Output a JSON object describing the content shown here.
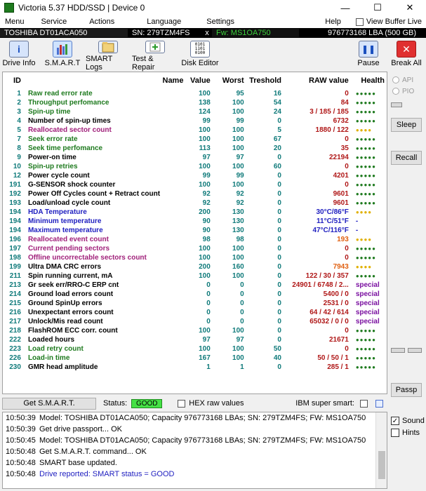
{
  "window": {
    "title": "Victoria 5.37 HDD/SSD | Device 0"
  },
  "menu": {
    "items": [
      "Menu",
      "Service",
      "Actions",
      "Language",
      "Settings"
    ],
    "help": "Help",
    "view_buffer_live": "View Buffer Live"
  },
  "device": {
    "model": "TOSHIBA DT01ACA050",
    "serial": "SN: 279TZM4FS",
    "close": "x",
    "firmware": "Fw: MS1OA750",
    "lba": "976773168 LBA (500 GB)"
  },
  "toolbar": {
    "drive_info": "Drive Info",
    "smart": "S.M.A.R.T",
    "smart_logs": "SMART Logs",
    "test_repair": "Test & Repair",
    "disk_editor": "Disk Editor",
    "pause": "Pause",
    "break_all": "Break All"
  },
  "table": {
    "headers": {
      "id": "ID",
      "name": "Name",
      "value": "Value",
      "worst": "Worst",
      "threshold": "Treshold",
      "raw": "RAW value",
      "health": "Health"
    },
    "rows": [
      {
        "id": "1",
        "name": "Raw read error rate",
        "value": "100",
        "worst": "95",
        "threshold": "16",
        "raw": "0",
        "health": "●●●●●",
        "name_color": "#1e7a1e",
        "raw_color": "#b01818",
        "health_color": "#1e7a1e"
      },
      {
        "id": "2",
        "name": "Throughput perfomance",
        "value": "138",
        "worst": "100",
        "threshold": "54",
        "raw": "84",
        "health": "●●●●●",
        "name_color": "#1e7a1e",
        "raw_color": "#b01818",
        "health_color": "#1e7a1e"
      },
      {
        "id": "3",
        "name": "Spin-up time",
        "value": "124",
        "worst": "100",
        "threshold": "24",
        "raw": "3 / 185 / 185",
        "health": "●●●●●",
        "name_color": "#1e7a1e",
        "raw_color": "#b01818",
        "health_color": "#1e7a1e"
      },
      {
        "id": "4",
        "name": "Number of spin-up times",
        "value": "99",
        "worst": "99",
        "threshold": "0",
        "raw": "6732",
        "health": "●●●●●",
        "name_color": "#000000",
        "raw_color": "#b01818",
        "health_color": "#1e7a1e"
      },
      {
        "id": "5",
        "name": "Reallocated sector count",
        "value": "100",
        "worst": "100",
        "threshold": "5",
        "raw": "1880 / 122",
        "health": "●●●●",
        "name_color": "#a0207a",
        "raw_color": "#b01818",
        "health_color": "#e0b000"
      },
      {
        "id": "7",
        "name": "Seek error rate",
        "value": "100",
        "worst": "100",
        "threshold": "67",
        "raw": "0",
        "health": "●●●●●",
        "name_color": "#1e7a1e",
        "raw_color": "#b01818",
        "health_color": "#1e7a1e"
      },
      {
        "id": "8",
        "name": "Seek time perfomance",
        "value": "113",
        "worst": "100",
        "threshold": "20",
        "raw": "35",
        "health": "●●●●●",
        "name_color": "#1e7a1e",
        "raw_color": "#b01818",
        "health_color": "#1e7a1e"
      },
      {
        "id": "9",
        "name": "Power-on time",
        "value": "97",
        "worst": "97",
        "threshold": "0",
        "raw": "22194",
        "health": "●●●●●",
        "name_color": "#000000",
        "raw_color": "#b01818",
        "health_color": "#1e7a1e"
      },
      {
        "id": "10",
        "name": "Spin-up retries",
        "value": "100",
        "worst": "100",
        "threshold": "60",
        "raw": "0",
        "health": "●●●●●",
        "name_color": "#1e7a1e",
        "raw_color": "#b01818",
        "health_color": "#1e7a1e"
      },
      {
        "id": "12",
        "name": "Power cycle count",
        "value": "99",
        "worst": "99",
        "threshold": "0",
        "raw": "4201",
        "health": "●●●●●",
        "name_color": "#000000",
        "raw_color": "#b01818",
        "health_color": "#1e7a1e"
      },
      {
        "id": "191",
        "name": "G-SENSOR shock counter",
        "value": "100",
        "worst": "100",
        "threshold": "0",
        "raw": "0",
        "health": "●●●●●",
        "name_color": "#000000",
        "raw_color": "#b01818",
        "health_color": "#1e7a1e"
      },
      {
        "id": "192",
        "name": "Power Off Cycles count + Retract count",
        "value": "92",
        "worst": "92",
        "threshold": "0",
        "raw": "9601",
        "health": "●●●●●",
        "name_color": "#000000",
        "raw_color": "#b01818",
        "health_color": "#1e7a1e"
      },
      {
        "id": "193",
        "name": "Load/unload cycle count",
        "value": "92",
        "worst": "92",
        "threshold": "0",
        "raw": "9601",
        "health": "●●●●●",
        "name_color": "#000000",
        "raw_color": "#b01818",
        "health_color": "#1e7a1e"
      },
      {
        "id": "194",
        "name": "HDA Temperature",
        "value": "200",
        "worst": "130",
        "threshold": "0",
        "raw": "30°C/86°F",
        "health": "●●●●",
        "name_color": "#2020c0",
        "raw_color": "#2020c0",
        "health_color": "#e0b000"
      },
      {
        "id": "194",
        "name": "Minimum temperature",
        "value": "90",
        "worst": "130",
        "threshold": "0",
        "raw": "11°C/51°F",
        "health": "-",
        "name_color": "#2020c0",
        "raw_color": "#2020c0",
        "health_color": "#2020c0"
      },
      {
        "id": "194",
        "name": "Maximum temperature",
        "value": "90",
        "worst": "130",
        "threshold": "0",
        "raw": "47°C/116°F",
        "health": "-",
        "name_color": "#2020c0",
        "raw_color": "#2020c0",
        "health_color": "#2020c0"
      },
      {
        "id": "196",
        "name": "Reallocated event count",
        "value": "98",
        "worst": "98",
        "threshold": "0",
        "raw": "193",
        "health": "●●●●",
        "name_color": "#a0207a",
        "raw_color": "#e06010",
        "health_color": "#e0b000"
      },
      {
        "id": "197",
        "name": "Current pending sectors",
        "value": "100",
        "worst": "100",
        "threshold": "0",
        "raw": "0",
        "health": "●●●●●",
        "name_color": "#a0207a",
        "raw_color": "#b01818",
        "health_color": "#1e7a1e"
      },
      {
        "id": "198",
        "name": "Offline uncorrectable sectors count",
        "value": "100",
        "worst": "100",
        "threshold": "0",
        "raw": "0",
        "health": "●●●●●",
        "name_color": "#a0207a",
        "raw_color": "#b01818",
        "health_color": "#1e7a1e"
      },
      {
        "id": "199",
        "name": "Ultra DMA CRC errors",
        "value": "200",
        "worst": "160",
        "threshold": "0",
        "raw": "7943",
        "health": "●●●●",
        "name_color": "#000000",
        "raw_color": "#e06010",
        "health_color": "#e0b000"
      },
      {
        "id": "211",
        "name": "Spin running current, mA",
        "value": "100",
        "worst": "100",
        "threshold": "0",
        "raw": "122 / 30 / 357",
        "health": "●●●●●",
        "name_color": "#000000",
        "raw_color": "#b01818",
        "health_color": "#1e7a1e"
      },
      {
        "id": "213",
        "name": "Gr seek err/RRO-C ERP cnt",
        "value": "0",
        "worst": "0",
        "threshold": "0",
        "raw": "24901 / 6748 / 2...",
        "health": "special",
        "name_color": "#000000",
        "raw_color": "#b01818",
        "health_color": "#7a10a0"
      },
      {
        "id": "214",
        "name": "Ground load errors count",
        "value": "0",
        "worst": "0",
        "threshold": "0",
        "raw": "5400 / 0",
        "health": "special",
        "name_color": "#000000",
        "raw_color": "#b01818",
        "health_color": "#7a10a0"
      },
      {
        "id": "215",
        "name": "Ground SpinUp errors",
        "value": "0",
        "worst": "0",
        "threshold": "0",
        "raw": "2531 / 0",
        "health": "special",
        "name_color": "#000000",
        "raw_color": "#b01818",
        "health_color": "#7a10a0"
      },
      {
        "id": "216",
        "name": "Unexpectant errors count",
        "value": "0",
        "worst": "0",
        "threshold": "0",
        "raw": "64 / 42 / 614",
        "health": "special",
        "name_color": "#000000",
        "raw_color": "#b01818",
        "health_color": "#7a10a0"
      },
      {
        "id": "217",
        "name": "Unlock/Mis read count",
        "value": "0",
        "worst": "0",
        "threshold": "0",
        "raw": "65032 / 0 / 0",
        "health": "special",
        "name_color": "#000000",
        "raw_color": "#b01818",
        "health_color": "#7a10a0"
      },
      {
        "id": "218",
        "name": "FlashROM ECC corr. count",
        "value": "100",
        "worst": "100",
        "threshold": "0",
        "raw": "0",
        "health": "●●●●●",
        "name_color": "#000000",
        "raw_color": "#b01818",
        "health_color": "#1e7a1e"
      },
      {
        "id": "222",
        "name": "Loaded hours",
        "value": "97",
        "worst": "97",
        "threshold": "0",
        "raw": "21671",
        "health": "●●●●●",
        "name_color": "#000000",
        "raw_color": "#b01818",
        "health_color": "#1e7a1e"
      },
      {
        "id": "223",
        "name": "Load retry count",
        "value": "100",
        "worst": "100",
        "threshold": "50",
        "raw": "0",
        "health": "●●●●●",
        "name_color": "#1e7a1e",
        "raw_color": "#b01818",
        "health_color": "#1e7a1e"
      },
      {
        "id": "226",
        "name": "Load-in time",
        "value": "167",
        "worst": "100",
        "threshold": "40",
        "raw": "50 / 50 / 1",
        "health": "●●●●●",
        "name_color": "#1e7a1e",
        "raw_color": "#b01818",
        "health_color": "#1e7a1e"
      },
      {
        "id": "230",
        "name": "GMR head amplitude",
        "value": "1",
        "worst": "1",
        "threshold": "0",
        "raw": "285 / 1",
        "health": "●●●●●",
        "name_color": "#000000",
        "raw_color": "#b01818",
        "health_color": "#1e7a1e"
      }
    ]
  },
  "right_panel": {
    "api": "API",
    "pio": "PIO",
    "sleep": "Sleep",
    "recall": "Recall",
    "passp": "Passp"
  },
  "status": {
    "get_smart": "Get S.M.A.R.T.",
    "status_label": "Status:",
    "status_value": "GOOD",
    "hex_raw": "HEX raw values",
    "ibm_super_smart": "IBM super smart:"
  },
  "log": [
    {
      "time": "10:50:39",
      "msg": "Model: TOSHIBA DT01ACA050; Capacity 976773168 LBAs; SN: 279TZM4FS; FW: MS1OA750",
      "color": "#000000"
    },
    {
      "time": "10:50:39",
      "msg": "Get drive passport... OK",
      "color": "#000000"
    },
    {
      "time": "10:50:45",
      "msg": "Model: TOSHIBA DT01ACA050; Capacity 976773168 LBAs; SN: 279TZM4FS; FW: MS1OA750",
      "color": "#000000"
    },
    {
      "time": "10:50:48",
      "msg": "Get S.M.A.R.T. command... OK",
      "color": "#000000"
    },
    {
      "time": "10:50:48",
      "msg": "SMART base updated.",
      "color": "#000000"
    },
    {
      "time": "10:50:48",
      "msg": "Drive reported: SMART status = GOOD",
      "color": "#2020c0"
    }
  ],
  "options": {
    "sound": "Sound",
    "hints": "Hints"
  }
}
